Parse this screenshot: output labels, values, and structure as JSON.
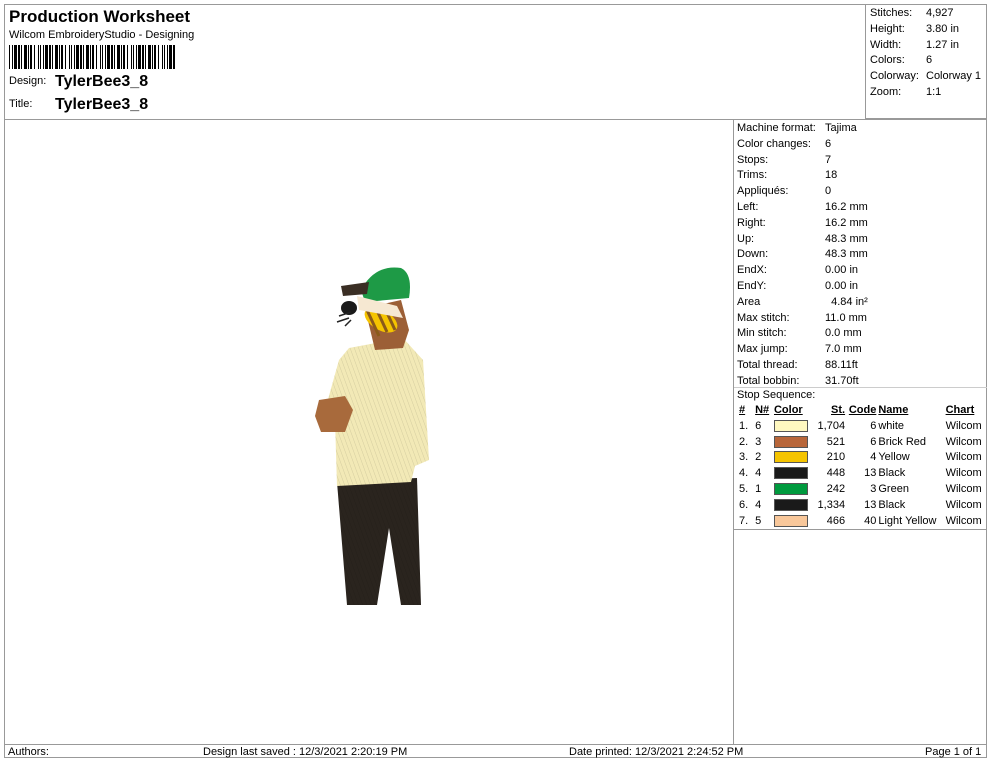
{
  "header": {
    "title": "Production Worksheet",
    "subtitle": "Wilcom EmbroideryStudio - Designing",
    "design_label": "Design:",
    "design_value": "TylerBee3_8",
    "title_label": "Title:",
    "title_value": "TylerBee3_8"
  },
  "summary": [
    {
      "k": "Stitches:",
      "v": "4,927"
    },
    {
      "k": "Height:",
      "v": "3.80 in"
    },
    {
      "k": "Width:",
      "v": "1.27 in"
    },
    {
      "k": "Colors:",
      "v": "6"
    },
    {
      "k": "Colorway:",
      "v": "Colorway 1"
    },
    {
      "k": "Zoom:",
      "v": "1:1"
    }
  ],
  "machine_info": [
    {
      "k": "Machine format:",
      "v": "Tajima"
    },
    {
      "k": "Color changes:",
      "v": "6"
    },
    {
      "k": "Stops:",
      "v": "7"
    },
    {
      "k": "Trims:",
      "v": "18"
    },
    {
      "k": "Appliqués:",
      "v": "0"
    },
    {
      "k": "Left:",
      "v": "16.2 mm"
    },
    {
      "k": "Right:",
      "v": "16.2 mm"
    },
    {
      "k": "Up:",
      "v": "48.3 mm"
    },
    {
      "k": "Down:",
      "v": "48.3 mm"
    },
    {
      "k": "EndX:",
      "v": "0.00 in"
    },
    {
      "k": "EndY:",
      "v": "0.00 in"
    },
    {
      "k": "Area",
      "v": "  4.84 in²"
    },
    {
      "k": "Max stitch:",
      "v": "11.0 mm"
    },
    {
      "k": "Min stitch:",
      "v": "0.0 mm"
    },
    {
      "k": "Max jump:",
      "v": "7.0 mm"
    },
    {
      "k": "Total thread:",
      "v": "88.11ft"
    },
    {
      "k": "Total bobbin:",
      "v": "31.70ft"
    }
  ],
  "stop_sequence": {
    "label": "Stop Sequence:",
    "headers": [
      "#",
      "N#",
      "Color",
      "St.",
      "Code",
      "Name",
      "Chart"
    ],
    "rows": [
      {
        "num": "1.",
        "n": "6",
        "color": "#FFF8C0",
        "st": "1,704",
        "code": "6",
        "name": "white",
        "chart": "Wilcom"
      },
      {
        "num": "2.",
        "n": "3",
        "color": "#B8663A",
        "st": "521",
        "code": "6",
        "name": "Brick Red",
        "chart": "Wilcom"
      },
      {
        "num": "3.",
        "n": "2",
        "color": "#F5C400",
        "st": "210",
        "code": "4",
        "name": "Yellow",
        "chart": "Wilcom"
      },
      {
        "num": "4.",
        "n": "4",
        "color": "#1A1A1A",
        "st": "448",
        "code": "13",
        "name": "Black",
        "chart": "Wilcom"
      },
      {
        "num": "5.",
        "n": "1",
        "color": "#009A3E",
        "st": "242",
        "code": "3",
        "name": "Green",
        "chart": "Wilcom"
      },
      {
        "num": "6.",
        "n": "4",
        "color": "#1A1A1A",
        "st": "1,334",
        "code": "13",
        "name": "Black",
        "chart": "Wilcom"
      },
      {
        "num": "7.",
        "n": "5",
        "color": "#F8C79A",
        "st": "466",
        "code": "40",
        "name": "Light Yellow",
        "chart": "Wilcom"
      }
    ]
  },
  "footer": {
    "authors": "Authors:",
    "saved": "Design last saved : 12/3/2021 2:20:19 PM",
    "printed": "Date printed: 12/3/2021 2:24:52 PM",
    "page": "Page 1 of 1"
  }
}
